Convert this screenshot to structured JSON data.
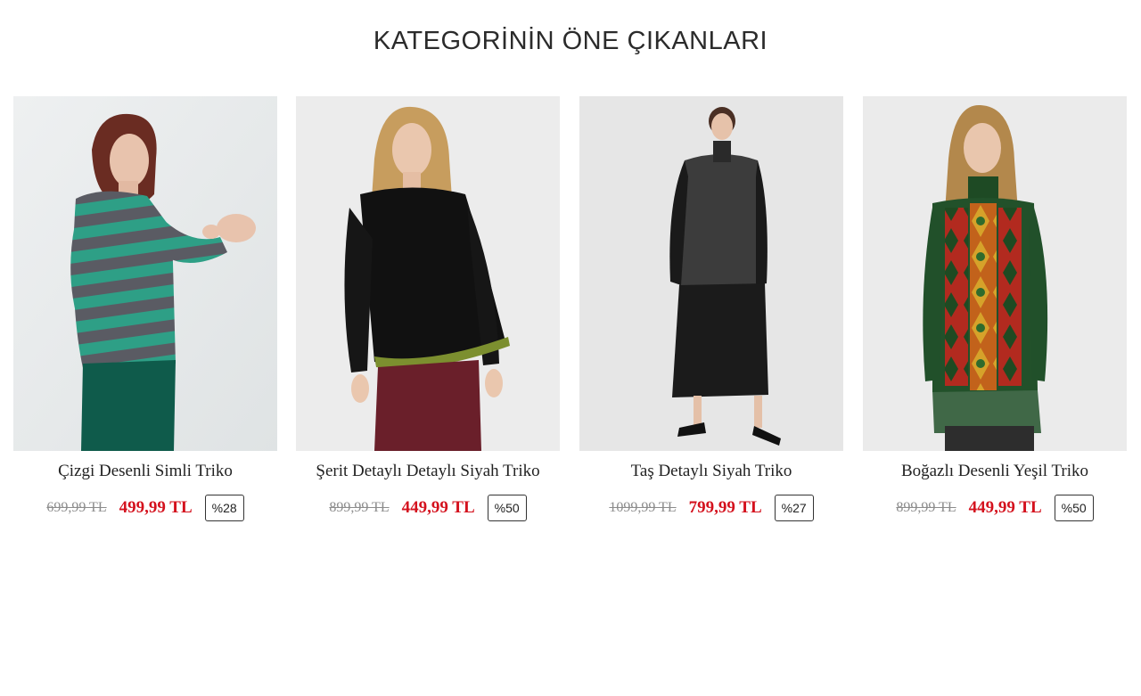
{
  "section": {
    "title": "KATEGORİNİN ÖNE ÇIKANLARI"
  },
  "products": [
    {
      "name": "Çizgi Desenli Simli Triko",
      "old_price": "699,99 TL",
      "new_price": "499,99 TL",
      "discount": "%28",
      "photo": "model-wearing-teal-grey-striped-sweater"
    },
    {
      "name": "Şerit Detaylı Detaylı Siyah Triko",
      "old_price": "899,99 TL",
      "new_price": "449,99 TL",
      "discount": "%50",
      "photo": "model-wearing-black-sweater-with-green-hem"
    },
    {
      "name": "Taş Detaylı Siyah Triko",
      "old_price": "1099,99 TL",
      "new_price": "799,99 TL",
      "discount": "%27",
      "photo": "model-wearing-grey-black-knit-and-pleated-skirt"
    },
    {
      "name": "Boğazlı Desenli Yeşil Triko",
      "old_price": "899,99 TL",
      "new_price": "449,99 TL",
      "discount": "%50",
      "photo": "model-wearing-green-patterned-turtleneck"
    }
  ],
  "colors": {
    "title": "#2b2b2b",
    "sale_price": "#d4111d",
    "old_price": "#8c8c8c",
    "photo_background": "#ebebeb"
  }
}
